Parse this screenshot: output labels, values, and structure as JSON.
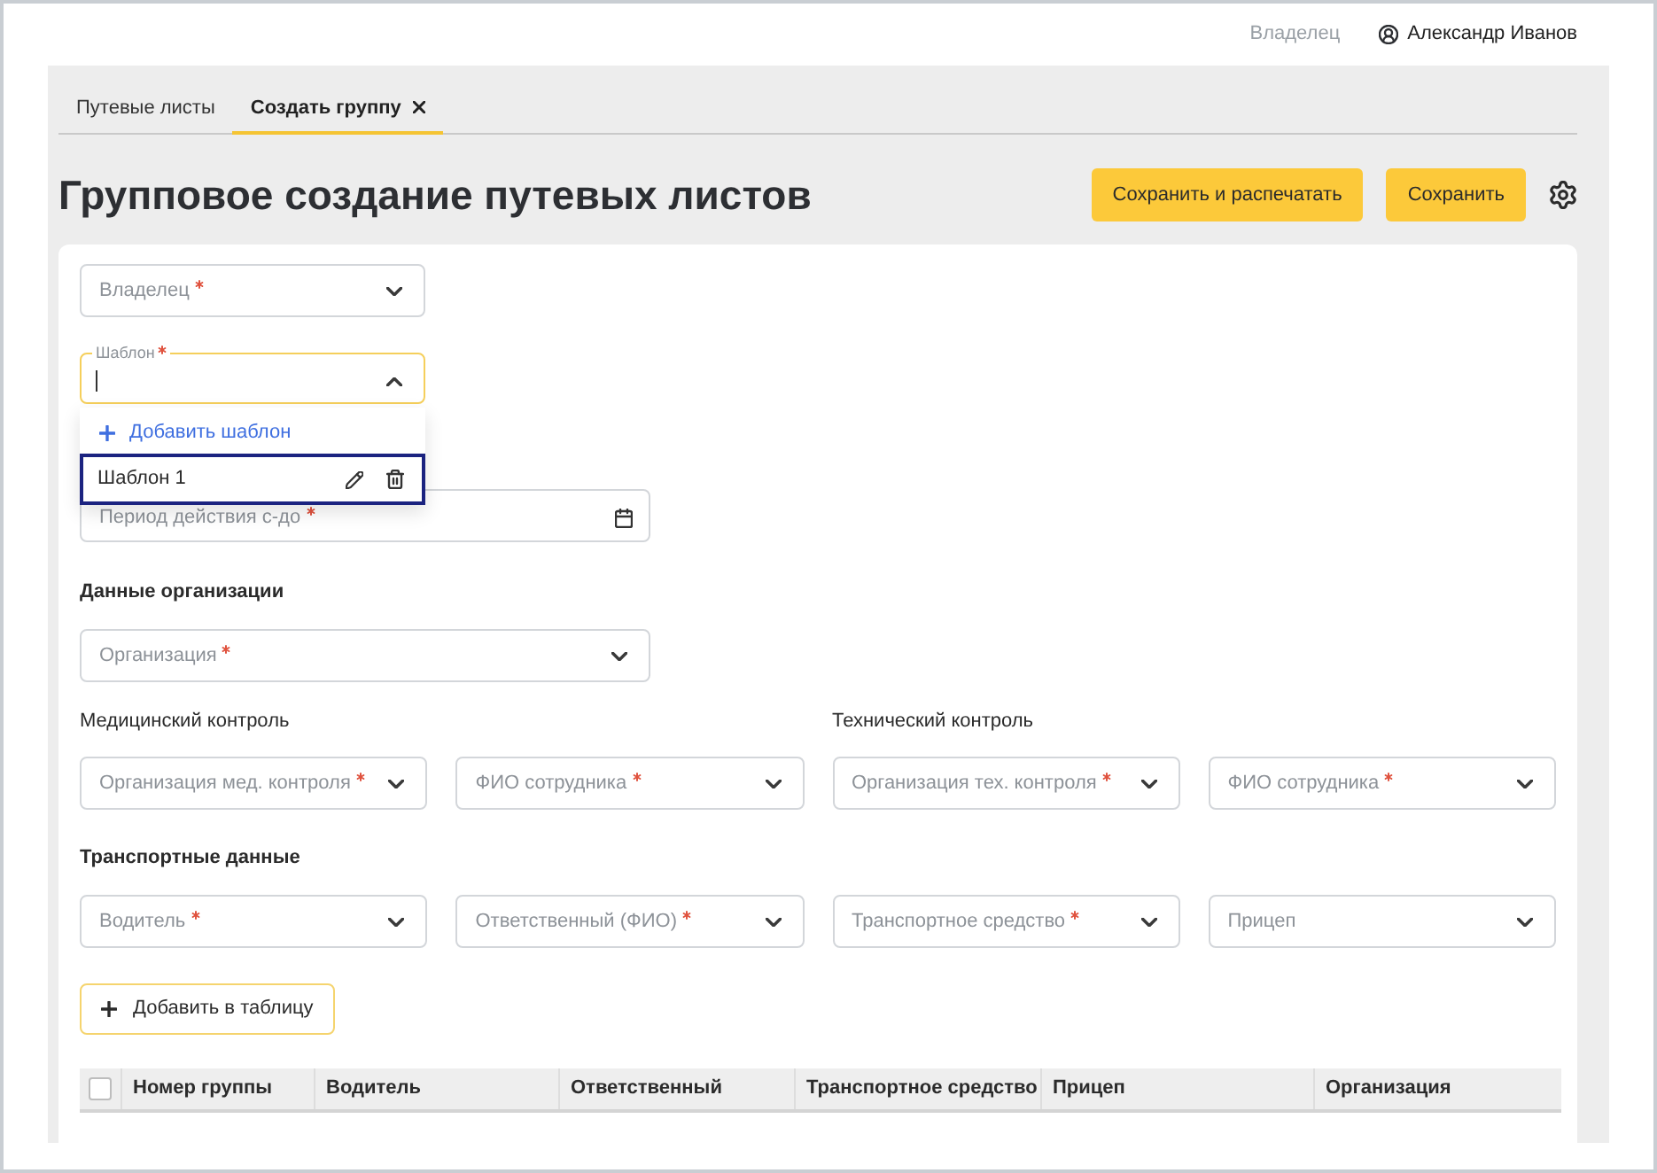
{
  "header": {
    "role": "Владелец",
    "user": "Александр Иванов"
  },
  "tabs": [
    {
      "label": "Путевые листы",
      "selected": false,
      "closable": false
    },
    {
      "label": "Создать группу",
      "selected": true,
      "closable": true
    }
  ],
  "title": "Групповое создание путевых листов",
  "actions": [
    {
      "label": "Сохранить и распечатать"
    },
    {
      "label": "Сохранить"
    }
  ],
  "owner": {
    "placeholder": "Владелец",
    "required": true
  },
  "template": {
    "label": "Шаблон",
    "required": true,
    "focused": true,
    "expanded": true,
    "menu": {
      "add_label": "Добавить шаблон",
      "items": [
        {
          "label": "Шаблон 1",
          "selected": true
        }
      ]
    }
  },
  "period": {
    "placeholder": "Период действия с-до",
    "required": true
  },
  "organization": {
    "title": "Данные организации",
    "fields": [
      {
        "placeholder": "Организация",
        "required": true
      }
    ]
  },
  "controls": [
    {
      "title": "Медицинский контроль",
      "fields": [
        {
          "placeholder": "Организация мед. контроля",
          "required": true
        },
        {
          "placeholder": "ФИО сотрудника",
          "required": true
        }
      ]
    },
    {
      "title": "Технический контроль",
      "fields": [
        {
          "placeholder": "Организация тех. контроля",
          "required": true
        },
        {
          "placeholder": "ФИО сотрудника",
          "required": true
        }
      ]
    }
  ],
  "transport": {
    "title": "Транспортные данные",
    "fields": [
      {
        "placeholder": "Водитель",
        "required": true
      },
      {
        "placeholder": "Ответственный (ФИО)",
        "required": true
      },
      {
        "placeholder": "Транспортное средство",
        "required": true
      },
      {
        "placeholder": "Прицеп",
        "required": false
      }
    ]
  },
  "add_button": "Добавить в таблицу",
  "table": {
    "select_all_checked": false,
    "columns": [
      "Номер группы",
      "Водитель",
      "Ответственный",
      "Транспортное средство",
      "Прицеп",
      "Организация"
    ]
  }
}
